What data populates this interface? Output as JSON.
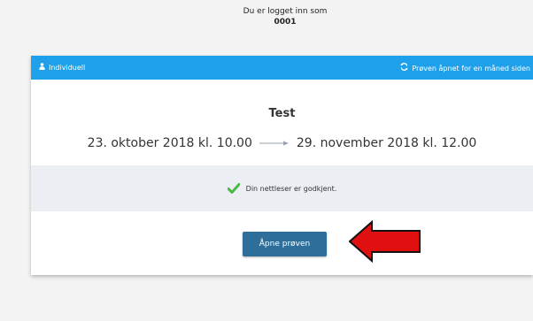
{
  "user": {
    "logged_in_label": "Du er logget inn som",
    "id": "0001"
  },
  "card": {
    "header_left": "Individuell",
    "header_right": "Prøven åpnet for en måned siden",
    "title": "Test",
    "start": "23. oktober 2018 kl. 10.00",
    "end": "29. november 2018 kl. 12.00",
    "status_text": "Din nettleser er godkjent.",
    "open_button": "Åpne prøven"
  },
  "colors": {
    "header_bg": "#1ea1ea",
    "button_bg": "#2d6f9a",
    "check": "#4cb848",
    "arrow_fill": "#e01010"
  },
  "icons": {
    "header_left": "user-icon",
    "header_right": "refresh-icon",
    "status": "checkmark-icon",
    "annotation": "red-arrow-icon"
  }
}
